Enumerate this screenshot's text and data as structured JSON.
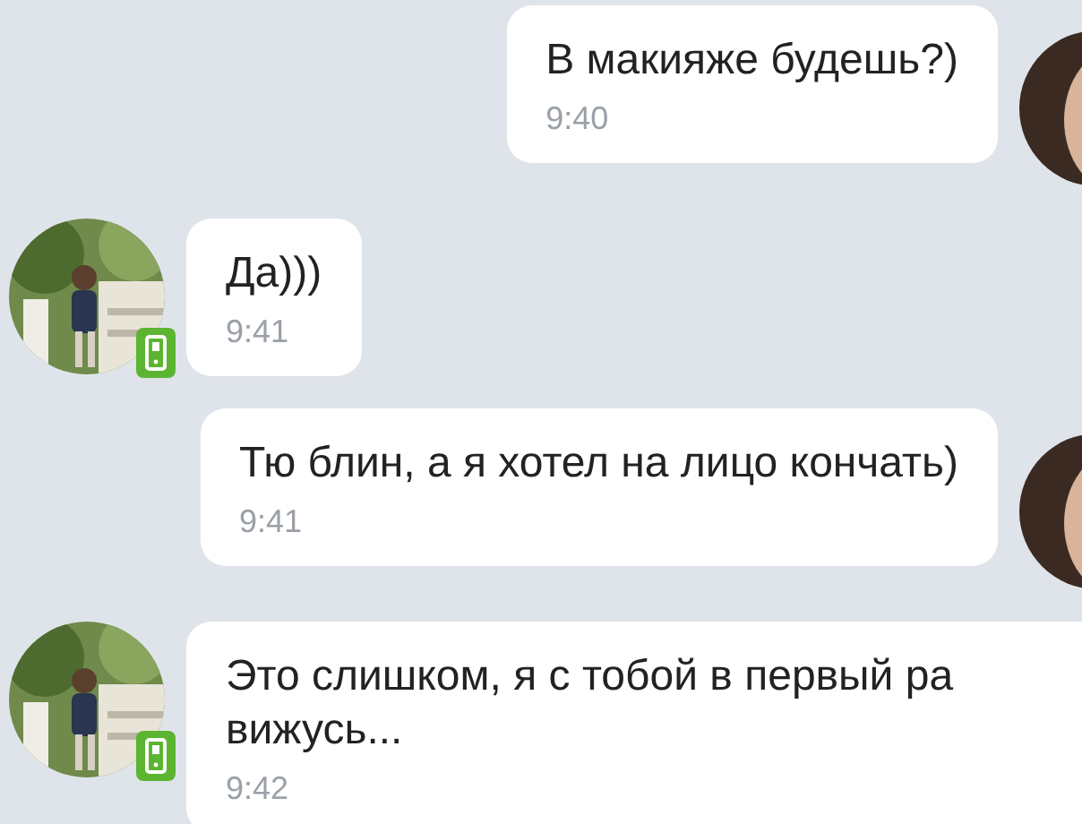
{
  "messages": [
    {
      "kind": "outgoing",
      "lines": [
        "В макияже будешь?)"
      ],
      "time": "9:40"
    },
    {
      "kind": "incoming",
      "lines": [
        "Да)))"
      ],
      "time": "9:41",
      "mobile": true
    },
    {
      "kind": "outgoing",
      "lines": [
        "Тю блин, а я хотел на лицо кончать)"
      ],
      "time": "9:41"
    },
    {
      "kind": "incoming",
      "lines": [
        "Это слишком, я с тобой в первый ра",
        "вижусь..."
      ],
      "time": "9:42",
      "mobile": true
    }
  ]
}
